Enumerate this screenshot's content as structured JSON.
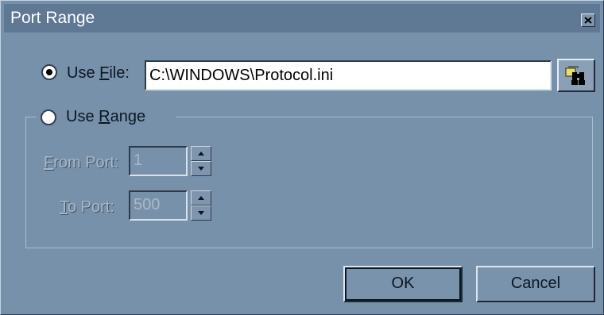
{
  "dialog": {
    "title": "Port Range",
    "close_icon": "close-icon"
  },
  "use_file": {
    "label_prefix": "Use ",
    "label_mnemonic": "F",
    "label_suffix": "ile:",
    "selected": true,
    "value": "C:\\WINDOWS\\Protocol.ini",
    "browse_icon": "binoculars-icon"
  },
  "use_range": {
    "label_prefix": "Use ",
    "label_mnemonic": "R",
    "label_suffix": "ange",
    "selected": false,
    "from_port": {
      "label_prefix": "",
      "label_mnemonic": "F",
      "label_suffix": "rom Port:",
      "value": "1",
      "enabled": false
    },
    "to_port": {
      "label_prefix": "",
      "label_mnemonic": "T",
      "label_suffix": "o Port:",
      "value": "500",
      "enabled": false
    }
  },
  "buttons": {
    "ok": "OK",
    "cancel": "Cancel"
  },
  "colors": {
    "dialog_background": "#7891ab",
    "titlebar": "#5f7894"
  }
}
